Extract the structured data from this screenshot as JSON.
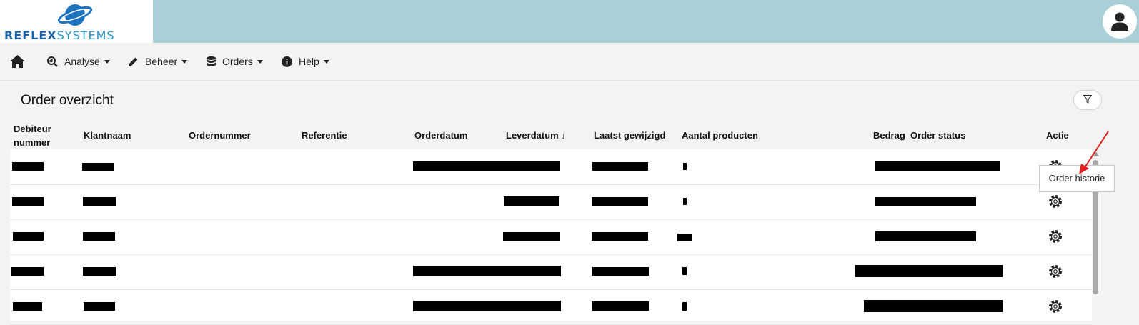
{
  "brand": {
    "logo_part1": "REFLEX",
    "logo_part2": "SYSTEMS"
  },
  "nav": {
    "home_icon": "home-icon",
    "items": [
      {
        "label": "Analyse",
        "icon": "search-chart-icon"
      },
      {
        "label": "Beheer",
        "icon": "pencil-icon"
      },
      {
        "label": "Orders",
        "icon": "database-icon"
      },
      {
        "label": "Help",
        "icon": "info-icon"
      }
    ]
  },
  "page": {
    "title": "Order overzicht"
  },
  "table": {
    "headers": {
      "debiteur_line1": "Debiteur",
      "debiteur_line2": "nummer",
      "klantnaam": "Klantnaam",
      "ordernummer": "Ordernummer",
      "referentie": "Referentie",
      "orderdatum": "Orderdatum",
      "leverdatum": "Leverdatum",
      "sort_arrow": "↓",
      "laatst_gewijzigd": "Laatst gewijzigd",
      "aantal_producten": "Aantal producten",
      "bedrag": "Bedrag",
      "order_status": "Order status",
      "actie": "Actie"
    },
    "row_count": 5,
    "cell_state": "redacted"
  },
  "tooltip": {
    "text": "Order historie"
  },
  "colors": {
    "topbar": "#a9d0d6",
    "logo_dark": "#1b63a6",
    "logo_light": "#2b93cc",
    "annotation": "#e02020"
  }
}
